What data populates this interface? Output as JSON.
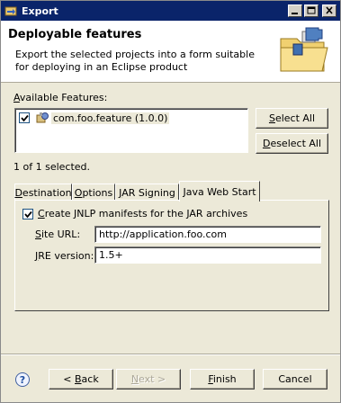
{
  "window": {
    "title": "Export"
  },
  "banner": {
    "title": "Deployable features",
    "description": "Export the selected projects into a form suitable for deploying in an Eclipse product"
  },
  "features": {
    "label_underlined": "A",
    "label_rest": "vailable Features:",
    "items": [
      {
        "label": "com.foo.feature (1.0.0)",
        "checked": true
      }
    ],
    "select_all": {
      "u": "S",
      "rest": "elect All"
    },
    "deselect_all": {
      "u": "D",
      "rest": "eselect All"
    },
    "status": "1 of 1 selected."
  },
  "tabs": [
    {
      "u": "D",
      "rest": "estination"
    },
    {
      "u": "O",
      "rest": "ptions"
    },
    {
      "u": "J",
      "rest": "AR Signing"
    },
    {
      "u": "",
      "rest": "Java Web Start"
    }
  ],
  "jws": {
    "create_jnlp": {
      "u": "C",
      "rest": "reate JNLP manifests for the JAR archives",
      "checked": true
    },
    "site_url": {
      "label_u": "S",
      "label_rest": "ite URL:",
      "value": "http://application.foo.com"
    },
    "jre_version": {
      "label_u": "J",
      "label_rest": "RE version:",
      "value": "1.5+"
    }
  },
  "footer": {
    "back": {
      "pre": "< ",
      "u": "B",
      "rest": "ack"
    },
    "next": {
      "u": "N",
      "rest": "ext >"
    },
    "finish": {
      "u": "F",
      "rest": "inish"
    },
    "cancel": "Cancel"
  }
}
